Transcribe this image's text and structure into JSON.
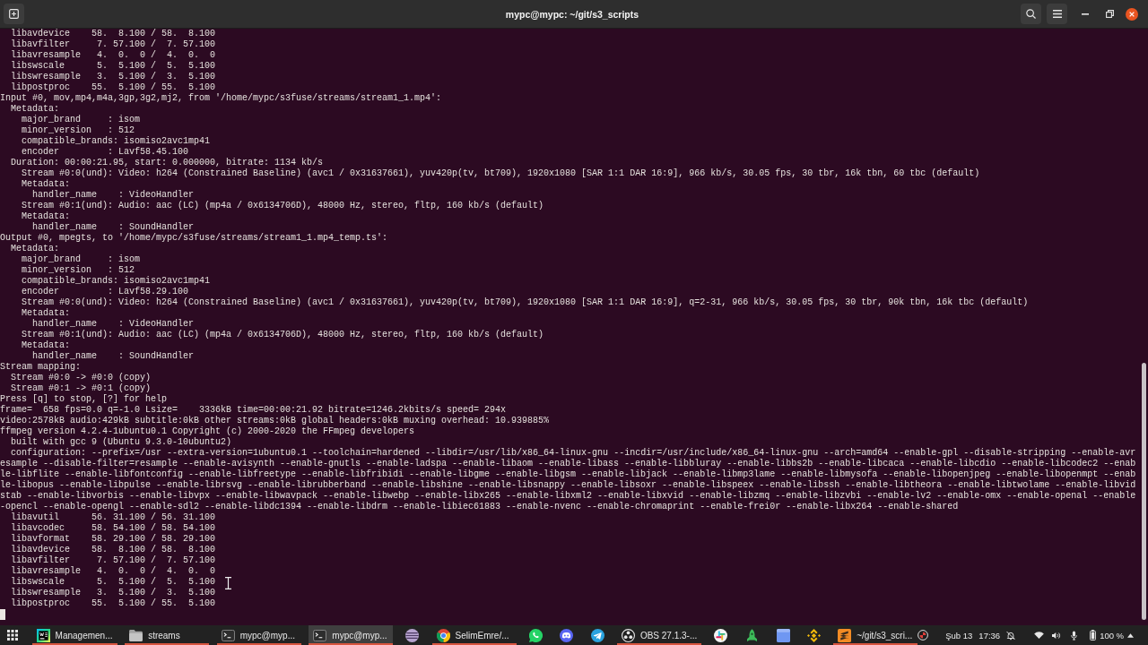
{
  "window": {
    "title": "mypc@mypc: ~/git/s3_scripts"
  },
  "terminal": {
    "lines": [
      "  libavdevice    58.  8.100 / 58.  8.100",
      "  libavfilter     7. 57.100 /  7. 57.100",
      "  libavresample   4.  0.  0 /  4.  0.  0",
      "  libswscale      5.  5.100 /  5.  5.100",
      "  libswresample   3.  5.100 /  3.  5.100",
      "  libpostproc    55.  5.100 / 55.  5.100",
      "Input #0, mov,mp4,m4a,3gp,3g2,mj2, from '/home/mypc/s3fuse/streams/stream1_1.mp4':",
      "  Metadata:",
      "    major_brand     : isom",
      "    minor_version   : 512",
      "    compatible_brands: isomiso2avc1mp41",
      "    encoder         : Lavf58.45.100",
      "  Duration: 00:00:21.95, start: 0.000000, bitrate: 1134 kb/s",
      "    Stream #0:0(und): Video: h264 (Constrained Baseline) (avc1 / 0x31637661), yuv420p(tv, bt709), 1920x1080 [SAR 1:1 DAR 16:9], 966 kb/s, 30.05 fps, 30 tbr, 16k tbn, 60 tbc (default)",
      "    Metadata:",
      "      handler_name    : VideoHandler",
      "    Stream #0:1(und): Audio: aac (LC) (mp4a / 0x6134706D), 48000 Hz, stereo, fltp, 160 kb/s (default)",
      "    Metadata:",
      "      handler_name    : SoundHandler",
      "Output #0, mpegts, to '/home/mypc/s3fuse/streams/stream1_1.mp4_temp.ts':",
      "  Metadata:",
      "    major_brand     : isom",
      "    minor_version   : 512",
      "    compatible_brands: isomiso2avc1mp41",
      "    encoder         : Lavf58.29.100",
      "    Stream #0:0(und): Video: h264 (Constrained Baseline) (avc1 / 0x31637661), yuv420p(tv, bt709), 1920x1080 [SAR 1:1 DAR 16:9], q=2-31, 966 kb/s, 30.05 fps, 30 tbr, 90k tbn, 16k tbc (default)",
      "    Metadata:",
      "      handler_name    : VideoHandler",
      "    Stream #0:1(und): Audio: aac (LC) (mp4a / 0x6134706D), 48000 Hz, stereo, fltp, 160 kb/s (default)",
      "    Metadata:",
      "      handler_name    : SoundHandler",
      "Stream mapping:",
      "  Stream #0:0 -> #0:0 (copy)",
      "  Stream #0:1 -> #0:1 (copy)",
      "Press [q] to stop, [?] for help",
      "frame=  658 fps=0.0 q=-1.0 Lsize=    3336kB time=00:00:21.92 bitrate=1246.2kbits/s speed= 294x",
      "video:2578kB audio:429kB subtitle:0kB other streams:0kB global headers:0kB muxing overhead: 10.939885%",
      "ffmpeg version 4.2.4-1ubuntu0.1 Copyright (c) 2000-2020 the FFmpeg developers",
      "  built with gcc 9 (Ubuntu 9.3.0-10ubuntu2)",
      "  configuration: --prefix=/usr --extra-version=1ubuntu0.1 --toolchain=hardened --libdir=/usr/lib/x86_64-linux-gnu --incdir=/usr/include/x86_64-linux-gnu --arch=amd64 --enable-gpl --disable-stripping --enable-avr",
      "esample --disable-filter=resample --enable-avisynth --enable-gnutls --enable-ladspa --enable-libaom --enable-libass --enable-libbluray --enable-libbs2b --enable-libcaca --enable-libcdio --enable-libcodec2 --enab",
      "le-libflite --enable-libfontconfig --enable-libfreetype --enable-libfribidi --enable-libgme --enable-libgsm --enable-libjack --enable-libmp3lame --enable-libmysofa --enable-libopenjpeg --enable-libopenmpt --enab",
      "le-libopus --enable-libpulse --enable-librsvg --enable-librubberband --enable-libshine --enable-libsnappy --enable-libsoxr --enable-libspeex --enable-libssh --enable-libtheora --enable-libtwolame --enable-libvid",
      "stab --enable-libvorbis --enable-libvpx --enable-libwavpack --enable-libwebp --enable-libx265 --enable-libxml2 --enable-libxvid --enable-libzmq --enable-libzvbi --enable-lv2 --enable-omx --enable-openal --enable",
      "-opencl --enable-opengl --enable-sdl2 --enable-libdc1394 --enable-libdrm --enable-libiec61883 --enable-nvenc --enable-chromaprint --enable-frei0r --enable-libx264 --enable-shared",
      "  libavutil      56. 31.100 / 56. 31.100",
      "  libavcodec     58. 54.100 / 58. 54.100",
      "  libavformat    58. 29.100 / 58. 29.100",
      "  libavdevice    58.  8.100 / 58.  8.100",
      "  libavfilter     7. 57.100 /  7. 57.100",
      "  libavresample   4.  0.  0 /  4.  0.  0",
      "  libswscale      5.  5.100 /  5.  5.100",
      "  libswresample   3.  5.100 /  3.  5.100",
      "  libpostproc    55.  5.100 / 55.  5.100"
    ]
  },
  "taskbar": {
    "items": [
      {
        "label": "Managemen...",
        "open": true,
        "selected": false
      },
      {
        "label": "streams",
        "open": true,
        "selected": false
      },
      {
        "label": "mypc@myp...",
        "open": true,
        "selected": false
      },
      {
        "label": "mypc@myp...",
        "open": true,
        "selected": true
      },
      {
        "open": false,
        "selected": false
      },
      {
        "label": "SelimEmre/...",
        "open": true,
        "selected": false
      },
      {
        "open": false,
        "selected": false
      },
      {
        "open": false,
        "selected": false
      },
      {
        "open": false,
        "selected": false
      },
      {
        "label": "OBS 27.1.3-...",
        "open": true,
        "selected": false
      },
      {
        "open": false,
        "selected": false
      },
      {
        "open": false,
        "selected": false
      },
      {
        "open": false,
        "selected": false
      },
      {
        "open": false,
        "selected": false
      },
      {
        "label": "~/git/s3_scri...",
        "open": true,
        "selected": false
      }
    ],
    "date": "Şub 13",
    "time": "17:36",
    "battery": "100 %"
  }
}
